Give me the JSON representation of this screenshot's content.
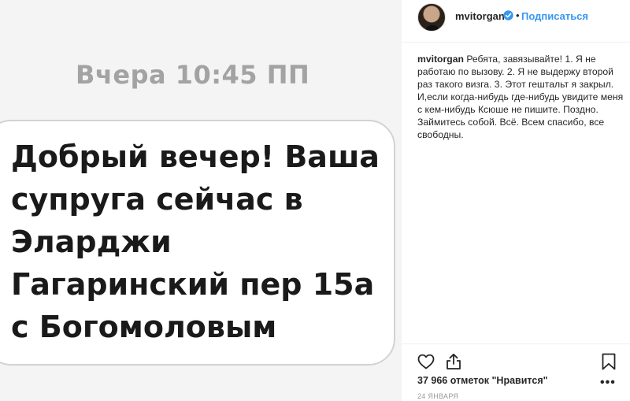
{
  "image": {
    "timestamp": "Вчера 10:45 ПП",
    "message_lines": [
      "Добрый вечер! Ваша",
      "супруга сейчас в",
      "Эларджи",
      "Гагаринский пер 15а",
      "с Богомоловым"
    ]
  },
  "header": {
    "username": "mvitorgan",
    "separator": "•",
    "follow_label": "Подписаться"
  },
  "caption": {
    "username": "mvitorgan",
    "text": "Ребята, завязывайте! 1. Я не работаю по вызову. 2. Я не выдержу второй раз такого визга. 3. Этот гештальт я закрыл. И,если когда-нибудь где-нибудь увидите меня с кем-нибудь Ксюше не пишите. Поздно. Займитесь собой. Всё. Всем спасибо, все свободны."
  },
  "footer": {
    "likes_text": "37 966 отметок \"Нравится\"",
    "date": "24 ЯНВАРЯ",
    "more_glyph": "•••"
  },
  "icons": {
    "like": "heart-icon",
    "share": "share-icon",
    "save": "bookmark-icon",
    "verified": "verified-badge-icon",
    "more": "more-options-icon"
  },
  "colors": {
    "accent": "#3897f0",
    "text": "#262626",
    "muted": "#999999",
    "timestamp_gray": "#a3a3a3"
  }
}
